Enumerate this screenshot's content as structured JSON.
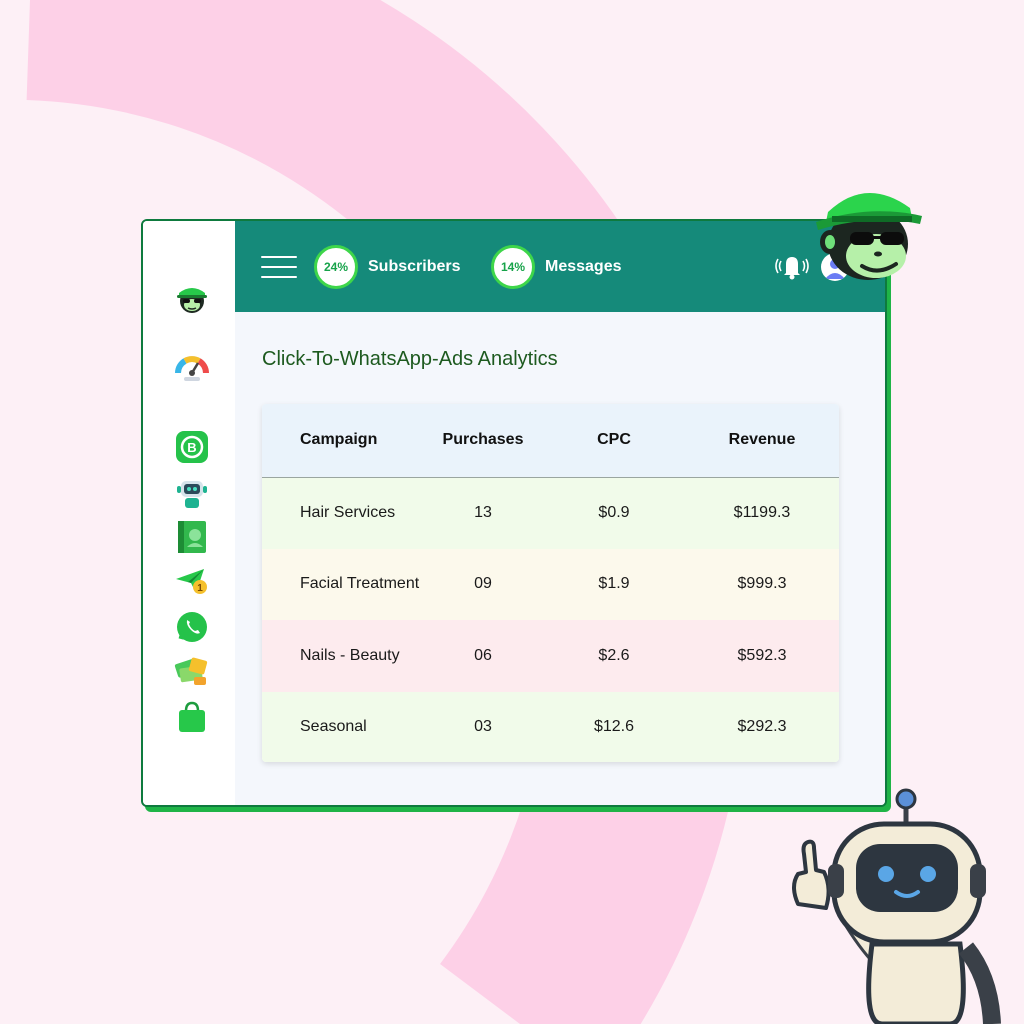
{
  "header": {
    "stats": [
      {
        "percent": "24%",
        "label": "Subscribers"
      },
      {
        "percent": "14%",
        "label": "Messages"
      }
    ]
  },
  "sidebar": {
    "icons": [
      "monkey-logo-icon",
      "speedometer-icon",
      "whatsapp-business-icon",
      "bot-icon",
      "contact-book-icon",
      "broadcast-plane-icon",
      "whatsapp-icon",
      "money-icon",
      "shopping-bag-icon"
    ]
  },
  "main": {
    "title": "Click-To-WhatsApp-Ads Analytics",
    "table": {
      "columns": [
        "Campaign",
        "Purchases",
        "CPC",
        "Revenue"
      ],
      "rows": [
        {
          "campaign": "Hair Services",
          "purchases": "13",
          "cpc": "$0.9",
          "revenue": "$1199.3"
        },
        {
          "campaign": "Facial Treatment",
          "purchases": "09",
          "cpc": "$1.9",
          "revenue": "$999.3"
        },
        {
          "campaign": "Nails - Beauty",
          "purchases": "06",
          "cpc": "$2.6",
          "revenue": "$592.3"
        },
        {
          "campaign": "Seasonal",
          "purchases": "03",
          "cpc": "$12.6",
          "revenue": "$292.3"
        }
      ]
    }
  },
  "colors": {
    "header_bg": "#158a7a",
    "accent_green": "#1fb447",
    "page_bg": "#fdf0f6",
    "arc_pink": "#fdd0e7"
  }
}
